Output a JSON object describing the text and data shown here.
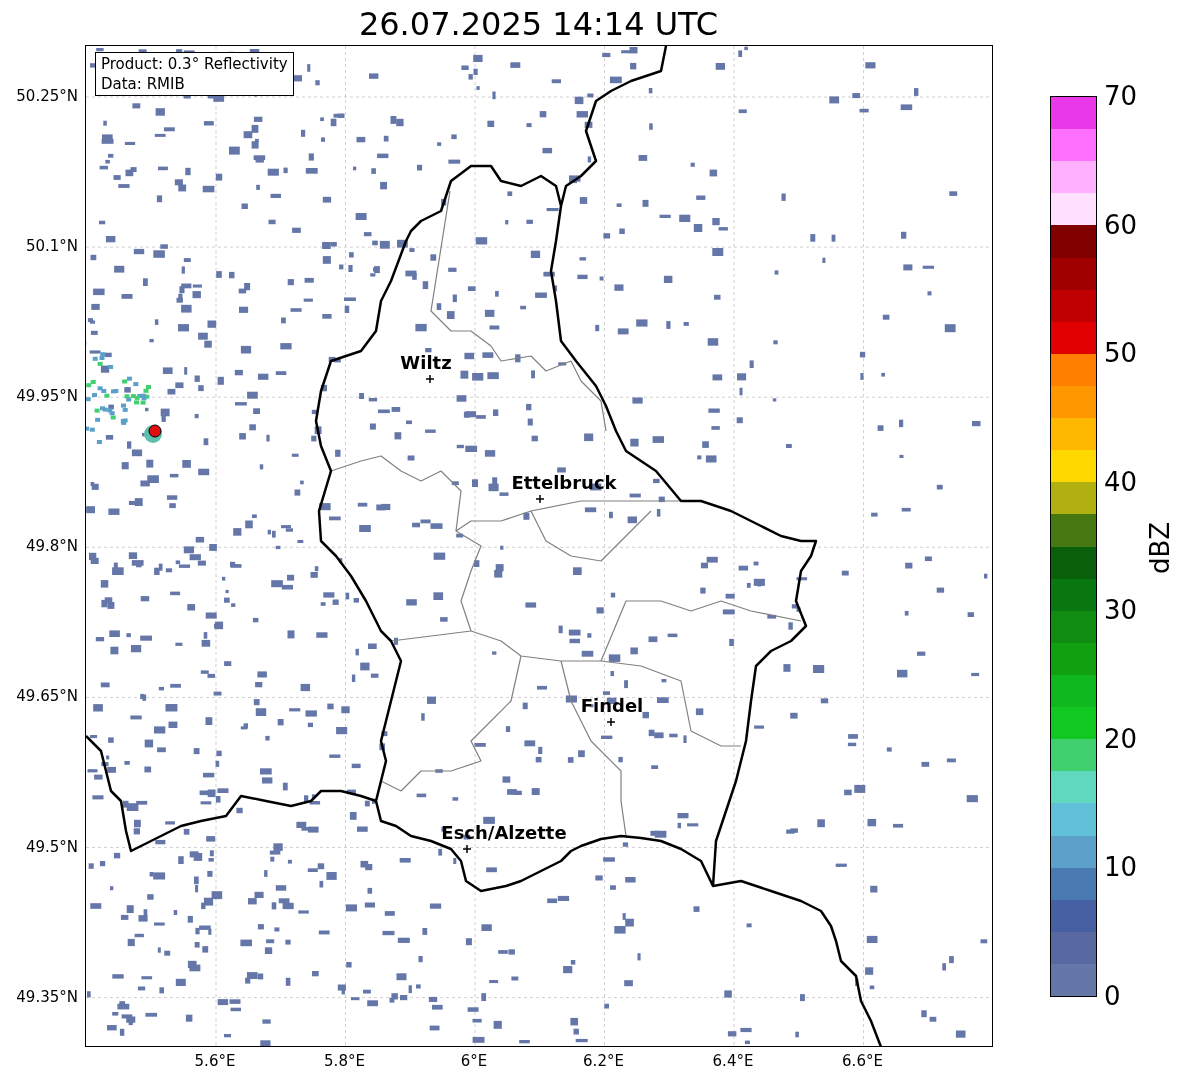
{
  "title": "26.07.2025 14:14 UTC",
  "info_box": {
    "lines": [
      "Product: 0.3° Reflectivity",
      "Data: RMIB"
    ]
  },
  "map": {
    "x_ticks": [
      "5.6°E",
      "5.8°E",
      "6°E",
      "6.2°E",
      "6.4°E",
      "6.6°E"
    ],
    "y_ticks": [
      "50.25°N",
      "50.1°N",
      "49.95°N",
      "49.8°N",
      "49.65°N",
      "49.5°N",
      "49.35°N"
    ],
    "cities": [
      {
        "name": "Wiltz"
      },
      {
        "name": "Ettelbruck"
      },
      {
        "name": "Findel"
      },
      {
        "name": "Esch/Alzette"
      }
    ]
  },
  "colorbar": {
    "label": "dBZ",
    "ticks": [
      "70",
      "60",
      "50",
      "40",
      "30",
      "20",
      "10",
      "0"
    ],
    "segments": [
      {
        "color": "#e838e8"
      },
      {
        "color": "#ff70ff"
      },
      {
        "color": "#ffb0ff"
      },
      {
        "color": "#ffe0ff"
      },
      {
        "color": "#800000"
      },
      {
        "color": "#a00000"
      },
      {
        "color": "#c00000"
      },
      {
        "color": "#e00000"
      },
      {
        "color": "#ff8000"
      },
      {
        "color": "#ff9800"
      },
      {
        "color": "#ffb800"
      },
      {
        "color": "#ffd800"
      },
      {
        "color": "#b0b010"
      },
      {
        "color": "#457810"
      },
      {
        "color": "#0a5f0a"
      },
      {
        "color": "#0a7810"
      },
      {
        "color": "#108c10"
      },
      {
        "color": "#10a010"
      },
      {
        "color": "#10b820"
      },
      {
        "color": "#10c820"
      },
      {
        "color": "#40d070"
      },
      {
        "color": "#60d8c0"
      },
      {
        "color": "#60c0d8"
      },
      {
        "color": "#5aa0c8"
      },
      {
        "color": "#4a7ab2"
      },
      {
        "color": "#4660a3"
      },
      {
        "color": "#5868a0"
      },
      {
        "color": "#6577a8"
      }
    ]
  }
}
